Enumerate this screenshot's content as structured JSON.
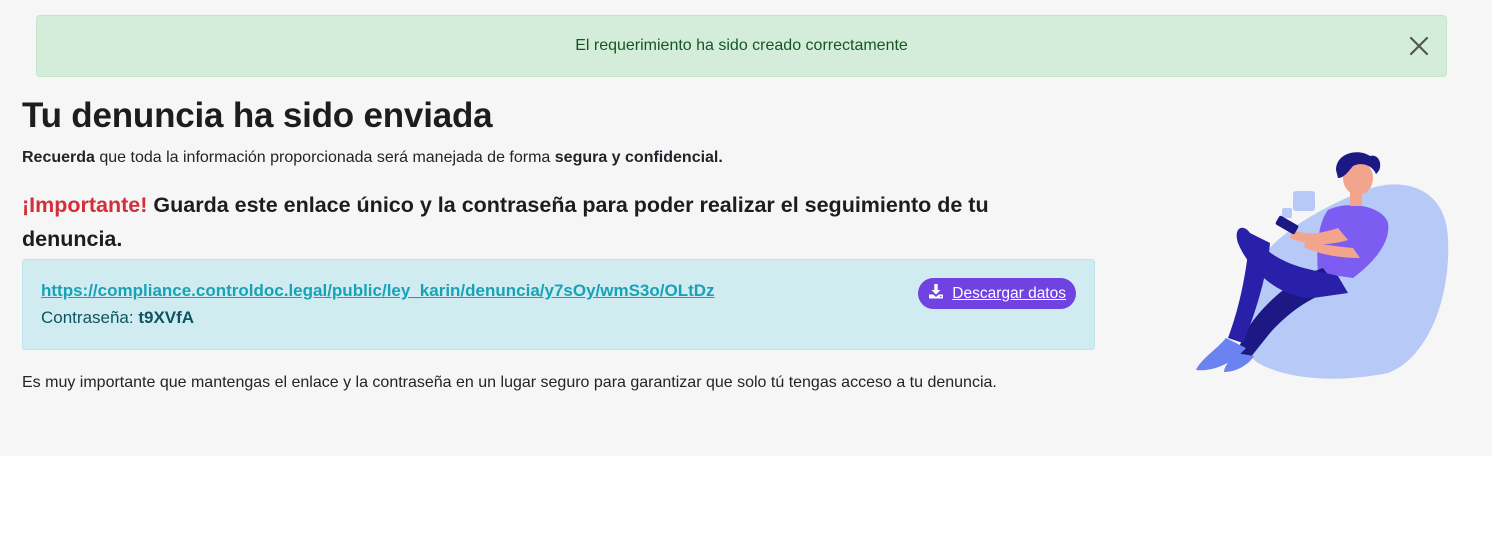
{
  "alert": {
    "message": "El requerimiento ha sido creado correctamente"
  },
  "header": {
    "title": "Tu denuncia ha sido enviada"
  },
  "reminder": {
    "lead": "Recuerda",
    "middle": " que toda la información proporcionada será manejada de forma ",
    "emphasis": "segura y confidencial."
  },
  "important": {
    "label": "¡Importante!",
    "text": " Guarda este enlace único y la contraseña para poder realizar el seguimiento de tu denuncia."
  },
  "credentials": {
    "url": "https://compliance.controldoc.legal/public/ley_karin/denuncia/y7sOy/wmS3o/OLtDz",
    "password_label": "Contraseña: ",
    "password": "t9XVfA",
    "download_label": "Descargar datos"
  },
  "note": {
    "text": "Es muy importante que mantengas el enlace y la contraseña en un lugar seguro para garantizar que solo tú tengas acceso a tu denuncia."
  },
  "colors": {
    "alert_bg": "#d4edda",
    "alert_text": "#155724",
    "info_bg": "#d1ecf1",
    "link": "#17a2b8",
    "button": "#6f42e1",
    "important_red": "#d32f3a"
  },
  "icons": {
    "close": "close-icon",
    "download": "download-icon",
    "illustration": "person-on-beanbag-illustration"
  }
}
